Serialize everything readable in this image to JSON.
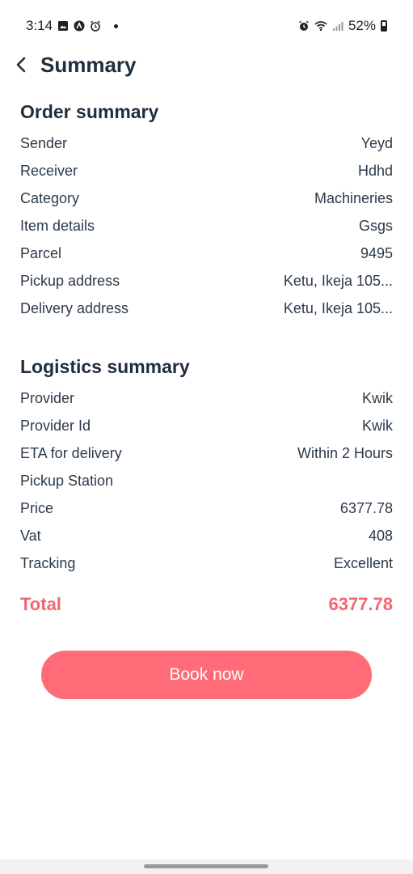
{
  "status_bar": {
    "time": "3:14",
    "battery_percent": "52%",
    "left_icons": [
      "gallery-icon",
      "app-icon",
      "alarm-icon",
      "dot-icon"
    ],
    "right_icons": [
      "alarm-icon",
      "wifi-icon",
      "signal-icon",
      "battery-icon"
    ]
  },
  "header": {
    "title": "Summary",
    "back_icon": "chevron-left-icon"
  },
  "order_summary": {
    "title": "Order summary",
    "rows": [
      {
        "label": "Sender",
        "value": "Yeyd"
      },
      {
        "label": "Receiver",
        "value": "Hdhd"
      },
      {
        "label": "Category",
        "value": "Machineries"
      },
      {
        "label": "Item details",
        "value": "Gsgs"
      },
      {
        "label": "Parcel",
        "value": "9495"
      },
      {
        "label": "Pickup address",
        "value": "Ketu, Ikeja 105..."
      },
      {
        "label": "Delivery address",
        "value": "Ketu, Ikeja 105..."
      }
    ]
  },
  "logistics_summary": {
    "title": "Logistics summary",
    "rows": [
      {
        "label": "Provider",
        "value": "Kwik"
      },
      {
        "label": "Provider Id",
        "value": "Kwik"
      },
      {
        "label": "ETA for delivery",
        "value": "Within 2 Hours"
      },
      {
        "label": "Pickup Station",
        "value": ""
      },
      {
        "label": "Price",
        "value": "6377.78"
      },
      {
        "label": "Vat",
        "value": "408"
      },
      {
        "label": "Tracking",
        "value": "Excellent"
      }
    ]
  },
  "total": {
    "label": "Total",
    "value": "6377.78"
  },
  "actions": {
    "book_now_label": "Book now"
  },
  "colors": {
    "accent": "#ff6b77",
    "total_text": "#f46672",
    "heading": "#1f2d3d",
    "text": "#2b3a4a"
  }
}
